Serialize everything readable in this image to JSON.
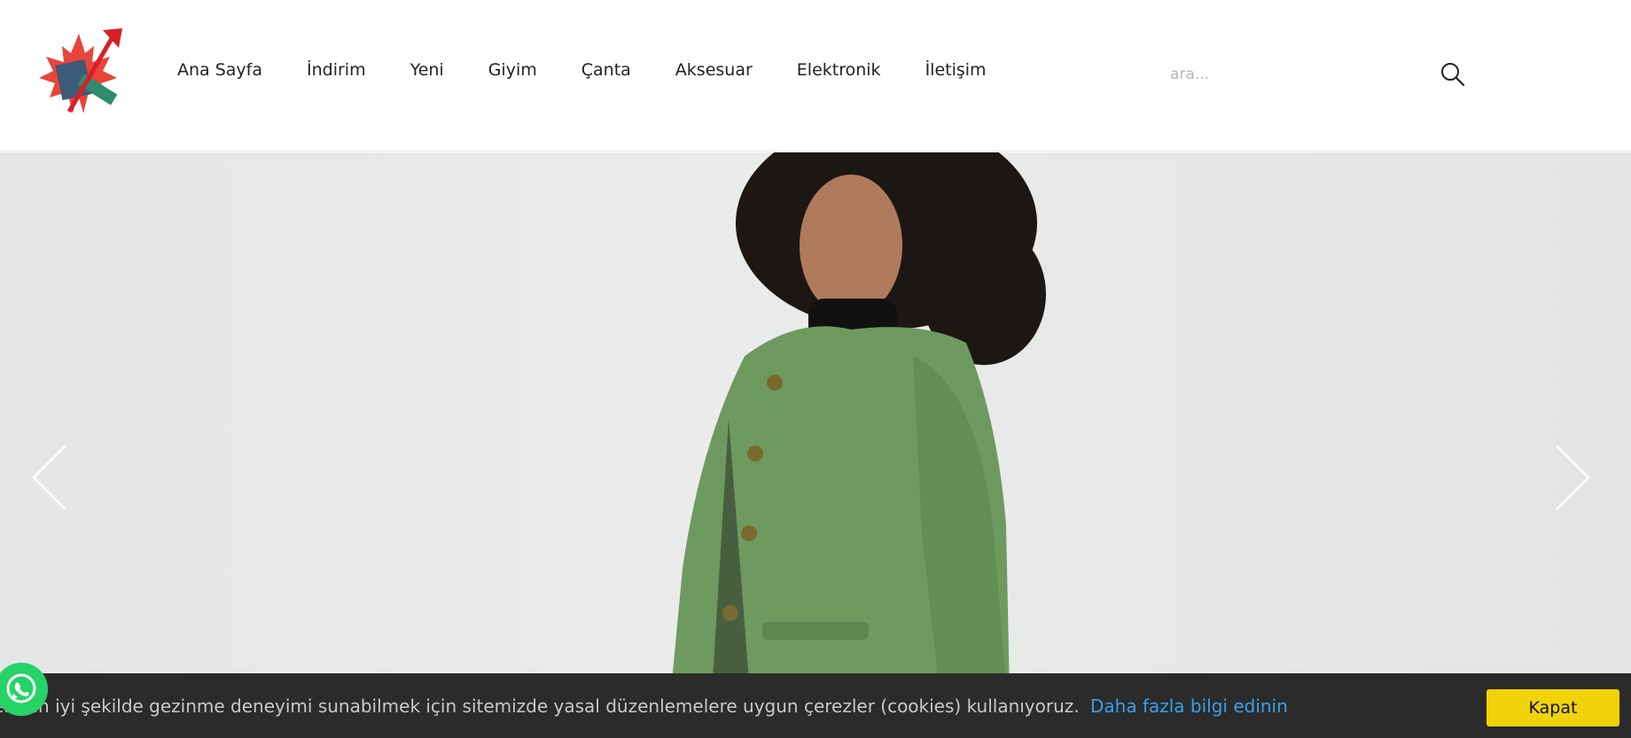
{
  "header": {
    "logo_icon": "maple-leaf-arrow-logo",
    "nav": [
      "Ana Sayfa",
      "İndirim",
      "Yeni",
      "Giyim",
      "Çanta",
      "Aksesuar",
      "Elektronik",
      "İletişim"
    ],
    "search": {
      "placeholder": "ara...",
      "value": "",
      "icon": "search-icon"
    }
  },
  "hero": {
    "slide_subject": "woman in green teddy coat",
    "prev_icon": "chevron-left-icon",
    "next_icon": "chevron-right-icon"
  },
  "cookie": {
    "text": "ere en iyi şekilde gezinme deneyimi sunabilmek için sitemizde yasal düzenlemelere uygun çerezler (cookies) kullanıyoruz.",
    "link": "Daha fazla bilgi edinin",
    "button": "Kapat"
  },
  "whatsapp": {
    "icon": "whatsapp-icon"
  },
  "colors": {
    "accent_yellow": "#f1d30b",
    "link_blue": "#3a9fe8",
    "cookie_bg": "#2b2b2b",
    "whatsapp_green": "#25d366"
  }
}
